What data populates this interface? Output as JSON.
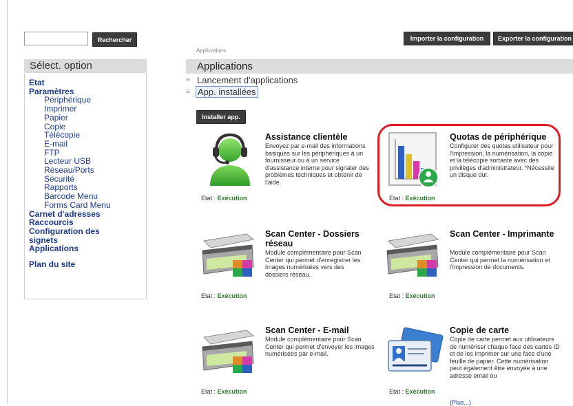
{
  "search": {
    "placeholder": "",
    "value": "",
    "button": "Rechercher"
  },
  "toolbar": {
    "import": "Importer la configuration",
    "export": "Exporter la configuration"
  },
  "nav": {
    "header": "Sélect. option",
    "items": [
      {
        "label": "Etat",
        "level": 0
      },
      {
        "label": "Paramètres",
        "level": 0
      },
      {
        "label": "Périphérique",
        "level": 1
      },
      {
        "label": "Imprimer",
        "level": 1
      },
      {
        "label": "Papier",
        "level": 1
      },
      {
        "label": "Copie",
        "level": 1
      },
      {
        "label": "Télécopie",
        "level": 1
      },
      {
        "label": "E-mail",
        "level": 1
      },
      {
        "label": "FTP",
        "level": 1
      },
      {
        "label": "Lecteur USB",
        "level": 1
      },
      {
        "label": "Réseau/Ports",
        "level": 1
      },
      {
        "label": "Sécurité",
        "level": 1
      },
      {
        "label": "Rapports",
        "level": 1
      },
      {
        "label": "Barcode Menu",
        "level": 1
      },
      {
        "label": "Forms Card Menu",
        "level": 1
      },
      {
        "label": "Carnet d'adresses",
        "level": 0
      },
      {
        "label": "Raccourcis",
        "level": 0
      },
      {
        "label": "Configuration des signets",
        "level": 0
      },
      {
        "label": "Applications",
        "level": 0
      }
    ],
    "sitemap": "Plan du site"
  },
  "main": {
    "breadcrumb": "Applications",
    "title": "Applications",
    "subsections": [
      "Lancement d'applications",
      "App. installées"
    ],
    "install_button": "Installer app.",
    "status_label": "Etat :",
    "status_value": "Exécution",
    "more_link": "(Plus...)",
    "apps": [
      {
        "title": "Assistance clientèle",
        "description": "Envoyez par e-mail des informations basiques sur les périphériques à un fournisseur ou à un service d'assistance interne pour signaler des problèmes techniques et obtenir de l'aide.",
        "icon": "headset-support-icon"
      },
      {
        "title": "Quotas de périphérique",
        "description": "Configurer des quotas utilisateur pour l'impression, la numérisation, la copie et la télécopie sortante avec des privilèges d'administrateur. *Nécessite un disque dur.",
        "icon": "quota-chart-icon"
      },
      {
        "title": "Scan Center - Dossiers réseau",
        "description": "Module complémentaire pour Scan Center qui permet d'enregistrer les images numérisées vers des dossiers réseau.",
        "icon": "scanner-folder-icon"
      },
      {
        "title": "Scan Center - Imprimante",
        "description": "Module complémentaire pour Scan Center qui permet la numérisation et l'impression de documents.",
        "icon": "scanner-printer-icon"
      },
      {
        "title": "Scan Center - E-mail",
        "description": "Module complémentaire pour Scan Center qui permet d'envoyer les images numérisées par e-mail.",
        "icon": "scanner-email-icon"
      },
      {
        "title": "Copie de carte",
        "description": "Copie de carte permet aux utilisateurs de numériser chaque face des cartes ID et de les imprimer sur une face d'une feuille de papier. Cette numérisation peut également être envoyée à une adresse email ou",
        "icon": "id-card-icon"
      }
    ]
  },
  "colors": {
    "accent_link": "#1a3a8a",
    "status_green": "#2a7a2a",
    "highlight_red": "#e01b22",
    "button_dark": "#3c3c3c"
  }
}
